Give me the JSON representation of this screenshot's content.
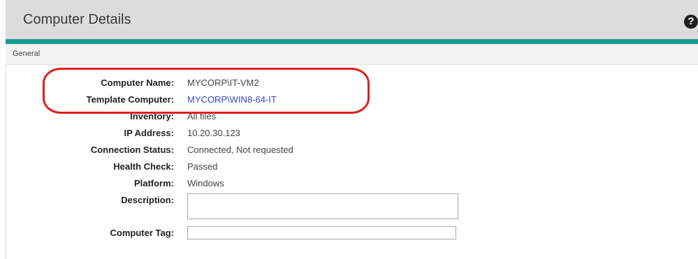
{
  "header": {
    "title": "Computer Details",
    "help_icon": "question-circle-icon"
  },
  "section": {
    "label": "General"
  },
  "fields": {
    "computer_name": {
      "label": "Computer Name:",
      "value": "MYCORP\\IT-VM2"
    },
    "template_computer": {
      "label": "Template Computer:",
      "value": "MYCORP\\WIN8-64-IT"
    },
    "inventory": {
      "label": "Inventory:",
      "value": "All files"
    },
    "ip_address": {
      "label": "IP Address:",
      "value": "10.20.30.123"
    },
    "connection_status": {
      "label": "Connection Status:",
      "value": "Connected, Not requested"
    },
    "health_check": {
      "label": "Health Check:",
      "value": "Passed"
    },
    "platform": {
      "label": "Platform:",
      "value": "Windows"
    },
    "description": {
      "label": "Description:",
      "value": ""
    },
    "computer_tag": {
      "label": "Computer Tag:",
      "value": ""
    }
  },
  "colors": {
    "accent": "#1a9c93",
    "highlight": "#e01f1f",
    "link": "#3b45c7"
  }
}
